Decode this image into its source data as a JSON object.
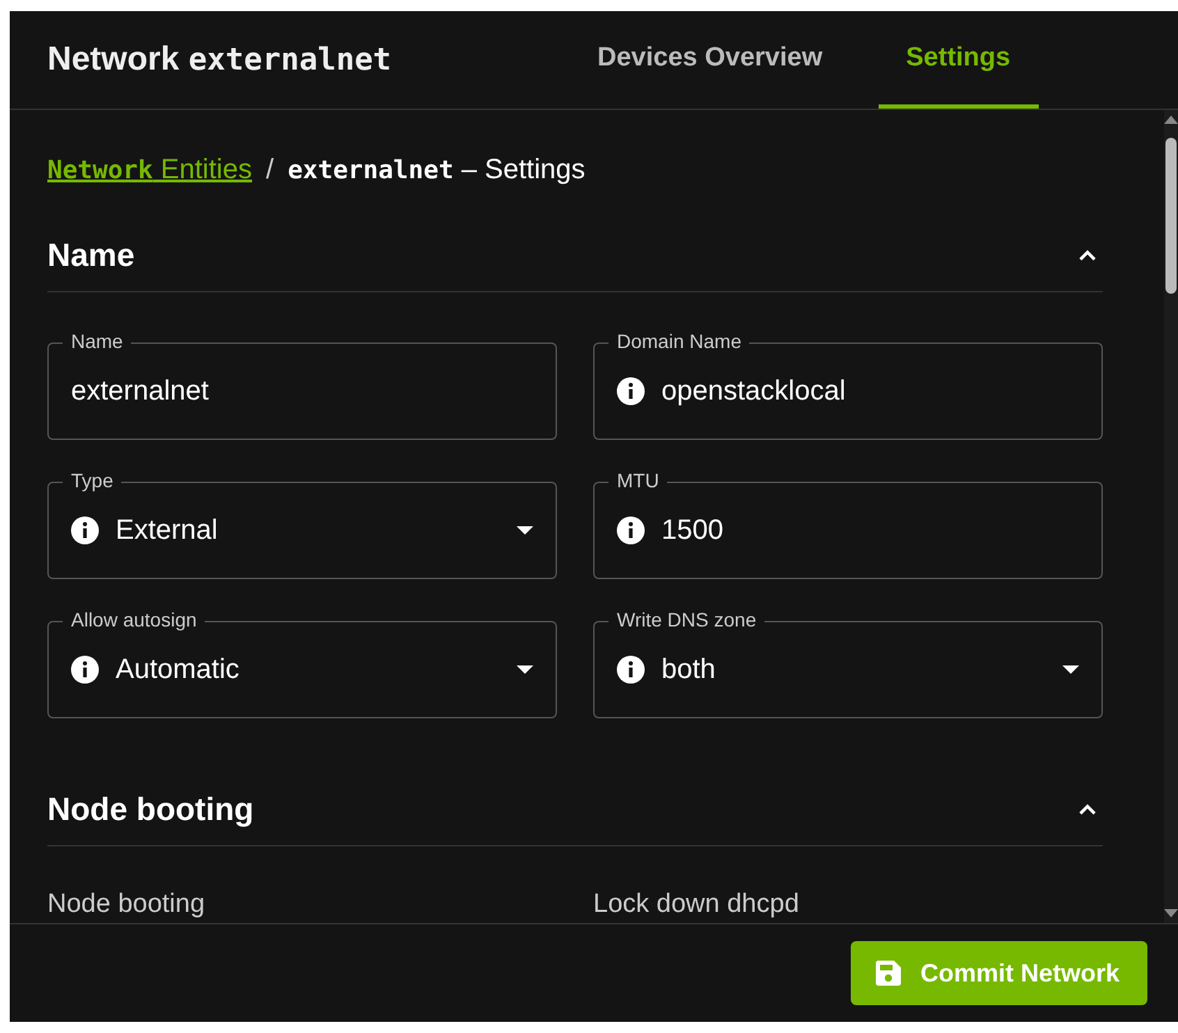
{
  "header": {
    "title": "Network **externalnet**"
  },
  "tabs": [
    {
      "label": "Devices Overview",
      "selected": false
    },
    {
      "label": "Settings",
      "selected": true
    }
  ],
  "breadcrumb": {
    "link": "**Network** Entities",
    "separator": "/",
    "current": "**externalnet** – Settings"
  },
  "sections": [
    {
      "title": "Name",
      "expanded": true,
      "fields": [
        {
          "kind": "text",
          "label": "Name",
          "value": "externalnet",
          "info": false
        },
        {
          "kind": "text",
          "label": "Domain Name",
          "value": "openstacklocal",
          "info": true
        },
        {
          "kind": "select",
          "label": "Type",
          "value": "External",
          "info": true
        },
        {
          "kind": "text",
          "label": "MTU",
          "value": "1500",
          "info": true
        },
        {
          "kind": "select",
          "label": "Allow autosign",
          "value": "Automatic",
          "info": true
        },
        {
          "kind": "select",
          "label": "Write DNS zone",
          "value": "both",
          "info": true
        }
      ]
    },
    {
      "title": "Node booting",
      "expanded": true,
      "fields": [
        {
          "kind": "label",
          "label": "Node booting"
        },
        {
          "kind": "label",
          "label": "Lock down dhcpd"
        }
      ]
    }
  ],
  "footer": {
    "button": "Commit Network"
  }
}
